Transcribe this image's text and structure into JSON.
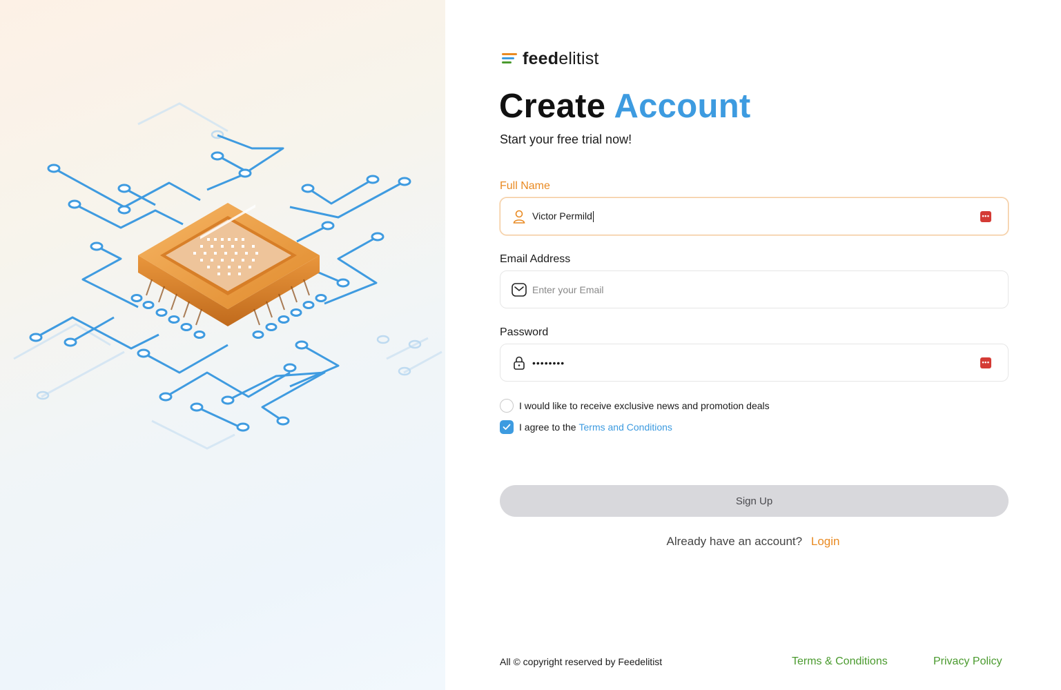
{
  "brand": {
    "name_bold": "feed",
    "name_light": "elitist",
    "colors": {
      "orange": "#e98a22",
      "blue": "#3d9be0",
      "green": "#4a9a2e"
    }
  },
  "heading": {
    "title_part1": "Create",
    "title_part2": "Account",
    "subtitle": "Start your free trial now!"
  },
  "form": {
    "full_name": {
      "label": "Full Name",
      "value": "Victor Permild",
      "icon": "user-icon"
    },
    "email": {
      "label": "Email Address",
      "placeholder": "Enter your Email",
      "icon": "mail-icon"
    },
    "password": {
      "label": "Password",
      "value": "••••••••",
      "icon": "lock-icon"
    },
    "password_manager_icon": "password-manager-icon",
    "news_opt_in": {
      "label": "I would like to receive exclusive news and promotion deals",
      "checked": false
    },
    "terms": {
      "prefix": "I agree to the",
      "link": "Terms and Conditions",
      "checked": true
    },
    "submit_label": "Sign Up"
  },
  "login_prompt": {
    "text": "Already have an account?",
    "link": "Login"
  },
  "footer": {
    "copyright": "All © copyright reserved by Feedelitist",
    "terms": "Terms & Conditions",
    "privacy": "Privacy Policy"
  }
}
